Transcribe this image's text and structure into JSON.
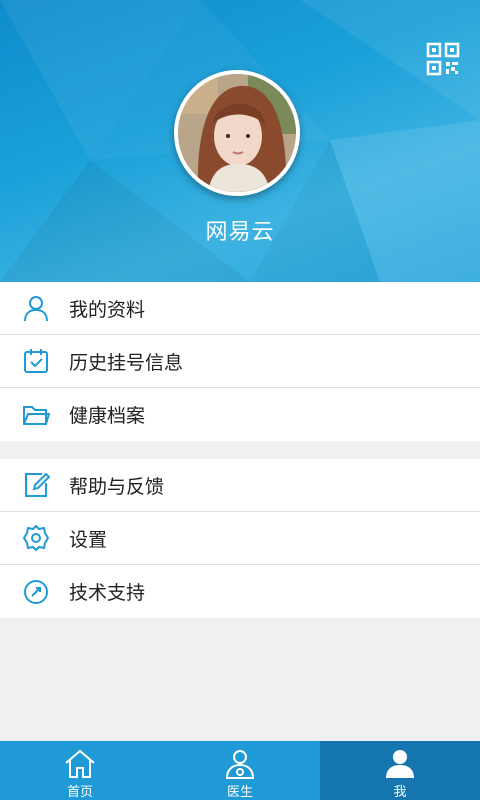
{
  "profile": {
    "username": "网易云"
  },
  "menu": {
    "group1": [
      {
        "label": "我的资料",
        "icon": "user-icon"
      },
      {
        "label": "历史挂号信息",
        "icon": "calendar-check-icon"
      },
      {
        "label": "健康档案",
        "icon": "folder-icon"
      }
    ],
    "group2": [
      {
        "label": "帮助与反馈",
        "icon": "edit-icon"
      },
      {
        "label": "设置",
        "icon": "gear-icon"
      },
      {
        "label": "技术支持",
        "icon": "compass-icon"
      }
    ]
  },
  "tabs": [
    {
      "label": "首页",
      "icon": "home-icon"
    },
    {
      "label": "医生",
      "icon": "doctor-icon"
    },
    {
      "label": "我",
      "icon": "person-icon",
      "active": true
    }
  ],
  "colors": {
    "header_blue": "#1aa0d9",
    "icon_blue": "#1f9ad6",
    "tabbar_blue": "#1f9ad6",
    "tab_active": "#1677b0"
  }
}
